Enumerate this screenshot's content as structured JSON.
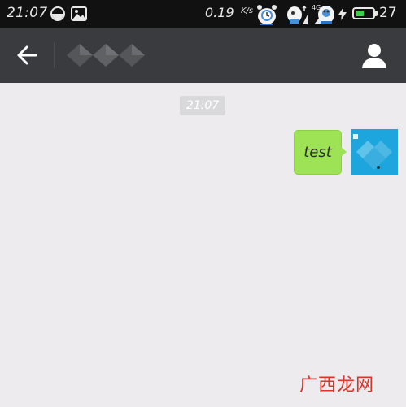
{
  "status_bar": {
    "time": "21:07",
    "speed": "0.19",
    "speed_unit": "K/s",
    "network": "4G",
    "battery_level": 0.5,
    "battery_percent": "27",
    "icons": [
      "half-circle-icon",
      "gallery-icon",
      "mascot-alarm-icon",
      "mascot-signal-icon",
      "mascot-bluetooth-icon",
      "charging-bolt-icon",
      "battery-icon"
    ]
  },
  "header": {
    "back_icon": "arrow-left-icon",
    "profile_icon": "person-icon"
  },
  "chat": {
    "timestamp": "21:07",
    "messages": [
      {
        "text": "test",
        "sender": "me"
      }
    ]
  },
  "watermark": "广西龙网",
  "colors": {
    "status_bar_bg": "#111111",
    "header_bg": "#3a3b3e",
    "chat_bg": "#edebee",
    "bubble_green": "#9ee255",
    "avatar_blue": "#1da6de",
    "battery_green": "#38d04a",
    "watermark_red": "#d9352b"
  }
}
